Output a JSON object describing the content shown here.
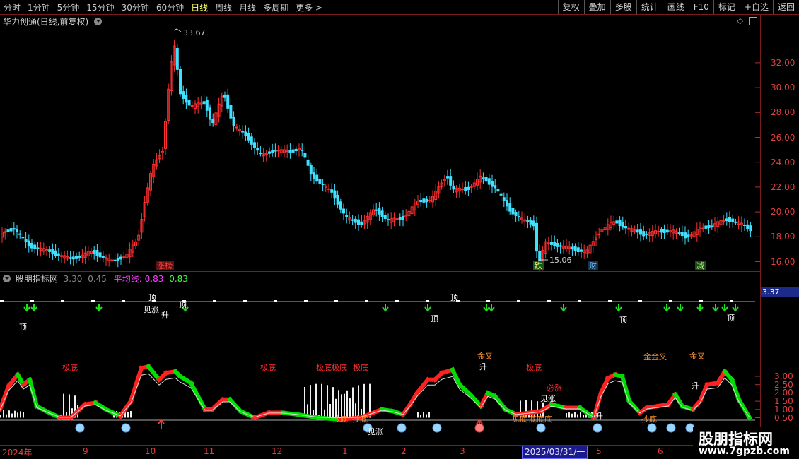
{
  "toolbar": {
    "periods": [
      "分时",
      "1分钟",
      "5分钟",
      "15分钟",
      "30分钟",
      "60分钟",
      "日线",
      "周线",
      "月线",
      "多周期",
      "更多 >"
    ],
    "active_period": "日线",
    "buttons": [
      "复权",
      "叠加",
      "多股",
      "统计",
      "画线",
      "F10",
      "标记",
      "+自选",
      "返回"
    ]
  },
  "main_chart": {
    "title": "华力创通(日线,前复权)",
    "y_ticks": [
      "32.00",
      "30.00",
      "28.00",
      "26.00",
      "24.00",
      "22.00",
      "20.00",
      "18.00",
      "16.00"
    ],
    "high_label": "33.67",
    "low_label": "15.06",
    "events": [
      {
        "text": "涨榜",
        "color": "#ff4040",
        "bg": "#5a1010"
      },
      {
        "text": "跌",
        "color": "#ffff80",
        "bg": "#1a5a1a"
      },
      {
        "text": "财",
        "color": "#80c0ff",
        "bg": "#10304a"
      },
      {
        "text": "减",
        "color": "#c0ff80",
        "bg": "#1a4a1a"
      }
    ]
  },
  "indicator": {
    "name": "股朋指标网",
    "v1": "3.30",
    "v2": "0.45",
    "avg_label": "平均线:",
    "avg1": "0.83",
    "avg2": "0.83",
    "y_ticks": [
      "3.00",
      "2.50",
      "2.00",
      "1.50",
      "1.00",
      "0.50"
    ],
    "current_value": "3.37",
    "signals": {
      "top": "顶",
      "sheng": "升",
      "jiandi": "极底",
      "jiandi_combo": "极底极底",
      "jianzhang": "见涨",
      "chaodi": "抄底",
      "jincha": "金叉",
      "jinjincha": "金金叉",
      "bizhang": "必涨",
      "jiandi2": "见底",
      "dijiandi": "底底底"
    }
  },
  "date_axis": {
    "labels": [
      "2024年",
      "9",
      "10",
      "11",
      "12",
      "1",
      "2",
      "3",
      "5",
      "6"
    ],
    "cursor": "2025/03/31/一"
  },
  "watermark": {
    "line1": "股朋指标网",
    "line2": "www.7gpzb.com"
  },
  "colors": {
    "up": "#ff2020",
    "down": "#00dd00",
    "candle_up": "#ff3030",
    "candle_down": "#40e0ff",
    "axis": "#e04040",
    "frame": "#7a1c1c"
  }
}
